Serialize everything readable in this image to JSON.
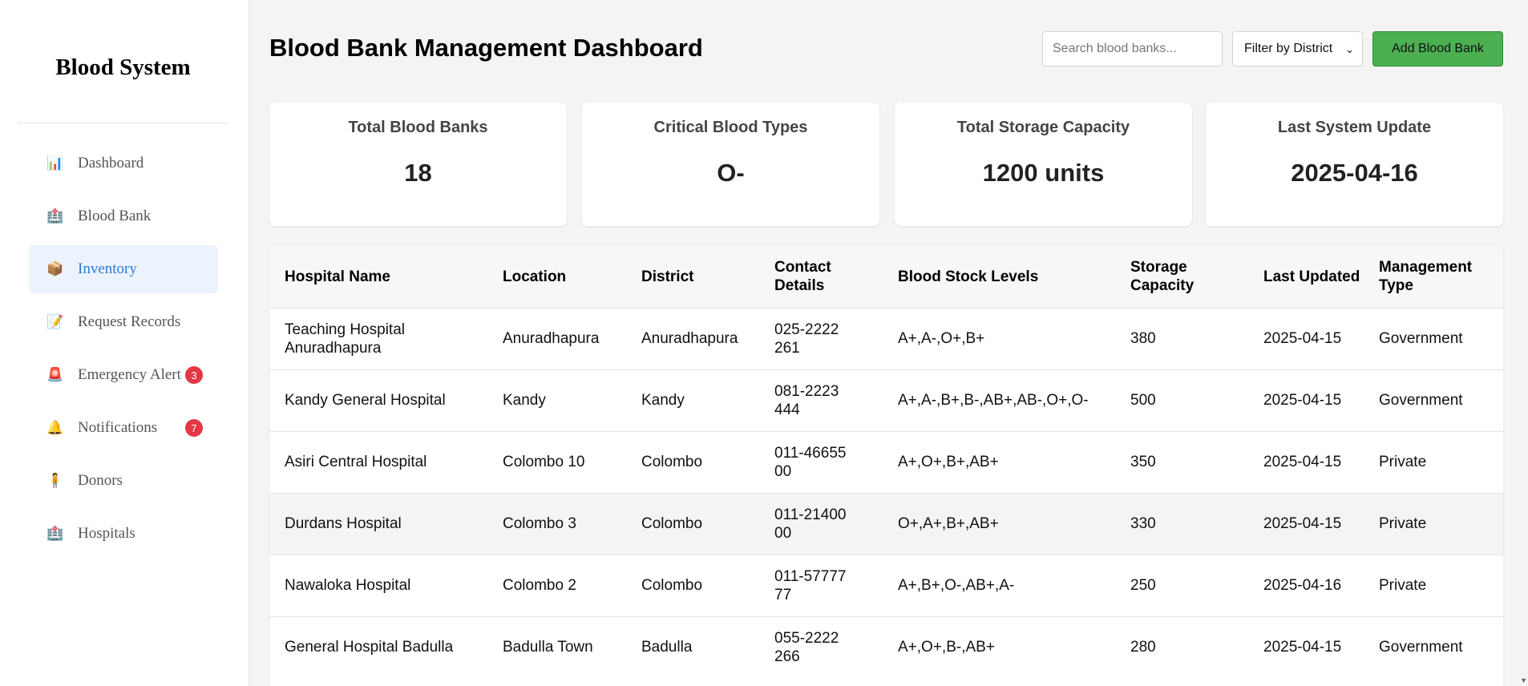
{
  "sidebar": {
    "brand": "Blood System",
    "items": [
      {
        "label": "Dashboard",
        "icon": "📊",
        "icon_name": "chart-icon",
        "active": false
      },
      {
        "label": "Blood Bank",
        "icon": "🏥",
        "icon_name": "hospital-icon",
        "active": false
      },
      {
        "label": "Inventory",
        "icon": "📦",
        "icon_name": "package-icon",
        "active": true
      },
      {
        "label": "Request Records",
        "icon": "📝",
        "icon_name": "memo-icon",
        "active": false
      },
      {
        "label": "Emergency Alert",
        "icon": "🚨",
        "icon_name": "siren-icon",
        "active": false,
        "badge": "3"
      },
      {
        "label": "Notifications",
        "icon": "🔔",
        "icon_name": "bell-icon",
        "active": false,
        "badge": "7"
      },
      {
        "label": "Donors",
        "icon": "🧍",
        "icon_name": "person-icon",
        "active": false
      },
      {
        "label": "Hospitals",
        "icon": "🏥",
        "icon_name": "hospital-icon",
        "active": false
      }
    ]
  },
  "header": {
    "title": "Blood Bank Management Dashboard",
    "search_placeholder": "Search blood banks...",
    "filter_label": "Filter by District",
    "add_button": "Add Blood Bank"
  },
  "stats": [
    {
      "label": "Total Blood Banks",
      "value": "18"
    },
    {
      "label": "Critical Blood Types",
      "value": "O-"
    },
    {
      "label": "Total Storage Capacity",
      "value": "1200 units"
    },
    {
      "label": "Last System Update",
      "value": "2025-04-16"
    }
  ],
  "table": {
    "columns": [
      "Hospital Name",
      "Location",
      "District",
      "Contact Details",
      "Blood Stock Levels",
      "Storage Capacity",
      "Last Updated",
      "Management Type"
    ],
    "rows": [
      [
        "Teaching Hospital Anuradhapura",
        "Anuradhapura",
        "Anuradhapura",
        "025-2222261",
        "A+,A-,O+,B+",
        "380",
        "2025-04-15",
        "Government"
      ],
      [
        "Kandy General Hospital",
        "Kandy",
        "Kandy",
        "081-2223444",
        "A+,A-,B+,B-,AB+,AB-,O+,O-",
        "500",
        "2025-04-15",
        "Government"
      ],
      [
        "Asiri Central Hospital",
        "Colombo 10",
        "Colombo",
        "011-4665500",
        "A+,O+,B+,AB+",
        "350",
        "2025-04-15",
        "Private"
      ],
      [
        "Durdans Hospital",
        "Colombo 3",
        "Colombo",
        "011-2140000",
        "O+,A+,B+,AB+",
        "330",
        "2025-04-15",
        "Private"
      ],
      [
        "Nawaloka Hospital",
        "Colombo 2",
        "Colombo",
        "011-5777777",
        "A+,B+,O-,AB+,A-",
        "250",
        "2025-04-16",
        "Private"
      ],
      [
        "General Hospital Badulla",
        "Badulla Town",
        "Badulla",
        "055-2222266",
        "A+,O+,B-,AB+",
        "280",
        "2025-04-15",
        "Government"
      ]
    ]
  },
  "colors": {
    "accent": "#2b7bd6",
    "active_bg": "#ebf3fd",
    "badge": "#e23744",
    "add_button": "#4caf50"
  }
}
